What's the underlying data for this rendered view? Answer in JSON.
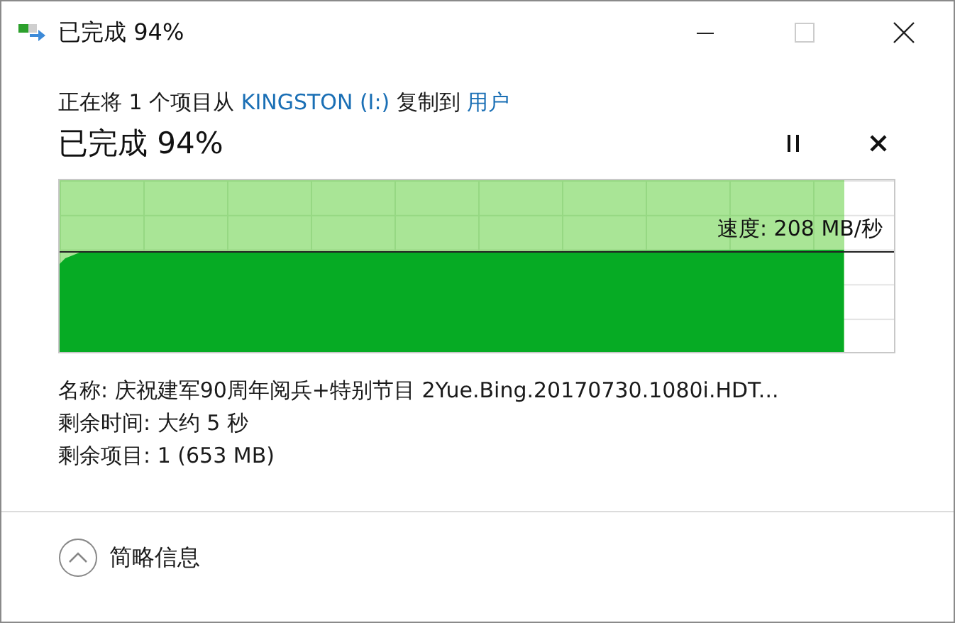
{
  "window": {
    "title": "已完成 94%"
  },
  "description": [
    {
      "kind": "text",
      "text": "正在将 1 个项目从"
    },
    {
      "kind": "link",
      "text": "KINGSTON (I:)"
    },
    {
      "kind": "text",
      "text": "复制到"
    },
    {
      "kind": "link",
      "text": "用户"
    }
  ],
  "heading": "已完成 94%",
  "progress": {
    "level": 0.94,
    "speed": "速度: 208 MB/秒"
  },
  "details": [
    "名称: 庆祝建军90周年阅兵+特别节目 2Yue.Bing.20170730.1080i.HDT...",
    "剩余时间: 大约 5 秒",
    "剩余项目: 1 (653 MB)"
  ],
  "footer": {
    "label": "简略信息"
  }
}
